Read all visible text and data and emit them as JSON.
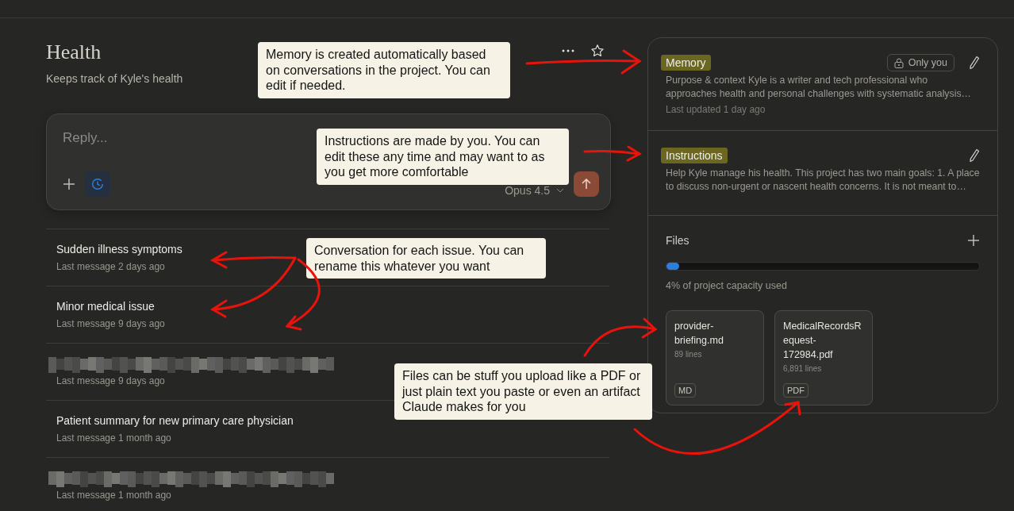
{
  "project": {
    "title": "Health",
    "description": "Keeps track of Kyle's health"
  },
  "composer": {
    "placeholder": "Reply...",
    "model": "Opus 4.5"
  },
  "conversations": [
    {
      "kind": "titled",
      "title": "Sudden illness symptoms",
      "meta": "Last message 2 days ago"
    },
    {
      "kind": "titled",
      "title": "Minor medical issue",
      "meta": "Last message 9 days ago"
    },
    {
      "kind": "redacted",
      "meta": "Last message 9 days ago"
    },
    {
      "kind": "titled",
      "title": "Patient summary for new primary care physician",
      "meta": "Last message 1 month ago"
    },
    {
      "kind": "redacted",
      "meta": "Last message 1 month ago"
    }
  ],
  "memory": {
    "title": "Memory",
    "highlighted": true,
    "visibility": "Only you",
    "text": "Purpose & context Kyle is a writer and tech professional who approaches health and personal challenges with systematic analysis…",
    "updated": "Last updated 1 day ago"
  },
  "instructions": {
    "title": "Instructions",
    "highlighted": true,
    "text": "Help Kyle manage his health. This project has two main goals: 1. A place to discuss non-urgent or nascent health concerns. It is not meant to…"
  },
  "files": {
    "title": "Files",
    "level": 0.04,
    "usage": "4% of project capacity used",
    "items": [
      {
        "name": "provider-briefing.md",
        "lines": "89 lines",
        "type": "MD"
      },
      {
        "name": "MedicalRecordsRequest-172984.pdf",
        "lines": "6,891 lines",
        "type": "PDF"
      }
    ]
  },
  "annotations": [
    {
      "kind": "memory",
      "text": "Memory is created automatically based on conversations in the project. You can edit if needed."
    },
    {
      "kind": "instructions",
      "text": "Instructions are made by you. You can edit these any time and may want to as you get more comfortable"
    },
    {
      "kind": "conversations",
      "text": "Conversation for each issue. You can rename this whatever you want"
    },
    {
      "kind": "files",
      "text": "Files can be stuff you upload like a PDF or just plain text you paste or even an artifact Claude makes for you"
    }
  ]
}
